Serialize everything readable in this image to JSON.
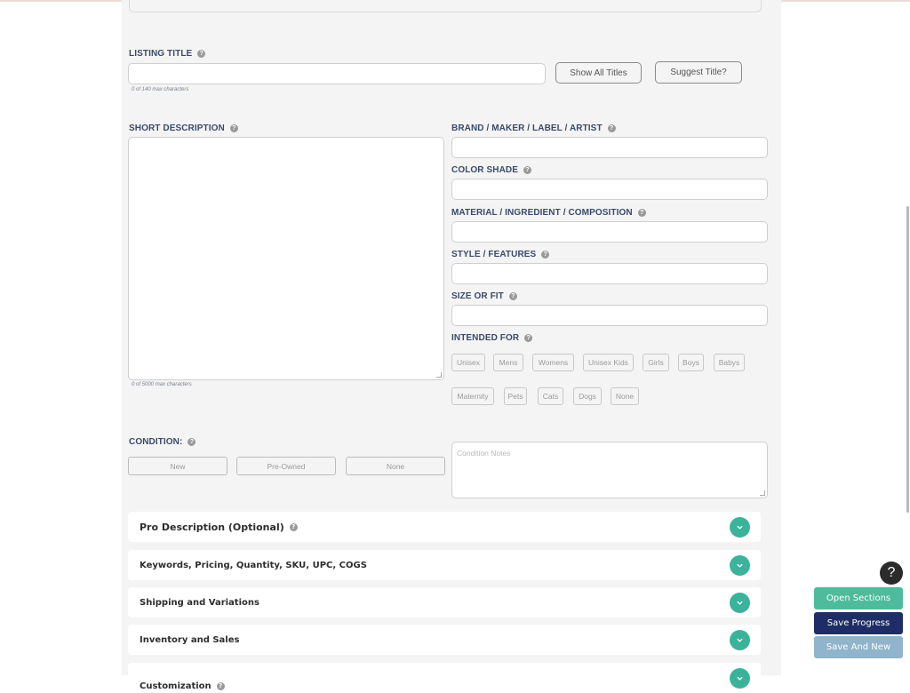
{
  "listing_title": {
    "label": "LISTING TITLE",
    "value": "",
    "hint": "0 of 140 max characters",
    "show_all_titles": "Show All Titles",
    "suggest_title": "Suggest Title?"
  },
  "short_description": {
    "label": "SHORT DESCRIPTION",
    "value": "",
    "hint": "0 of 5000 max characters"
  },
  "fields": [
    {
      "label": "BRAND / MAKER / LABEL / ARTIST",
      "value": ""
    },
    {
      "label": "COLOR SHADE",
      "value": ""
    },
    {
      "label": "MATERIAL / INGREDIENT / COMPOSITION",
      "value": ""
    },
    {
      "label": "STYLE / FEATURES",
      "value": ""
    },
    {
      "label": "SIZE OR FIT",
      "value": ""
    }
  ],
  "intended_for": {
    "label": "INTENDED FOR",
    "options": [
      "Unisex",
      "Mens",
      "Womens",
      "Unisex Kids",
      "Girls",
      "Boys",
      "Babys",
      "Maternity",
      "Pets",
      "Cats",
      "Dogs",
      "None"
    ]
  },
  "condition": {
    "label": "CONDITION:",
    "options": [
      "New",
      "Pre-Owned",
      "None"
    ],
    "notes_placeholder": "Condition Notes"
  },
  "sections": [
    {
      "title": "Pro Description (Optional)",
      "help": true
    },
    {
      "title": "Keywords, Pricing, Quantity, SKU, UPC, COGS",
      "help": false
    },
    {
      "title": "Shipping and Variations",
      "help": false
    },
    {
      "title": "Inventory and Sales",
      "help": false
    },
    {
      "title": "Customization",
      "help": true
    }
  ],
  "floating": {
    "help": "?",
    "open_sections": "Open Sections",
    "save_progress": "Save Progress",
    "save_and_new": "Save And New"
  },
  "colors": {
    "accent_teal": "#3bb39a",
    "open_sections": "#4dbb9c",
    "save_progress": "#1f2d66",
    "save_and_new": "#8fb4cb",
    "label": "#3a4a6b"
  }
}
